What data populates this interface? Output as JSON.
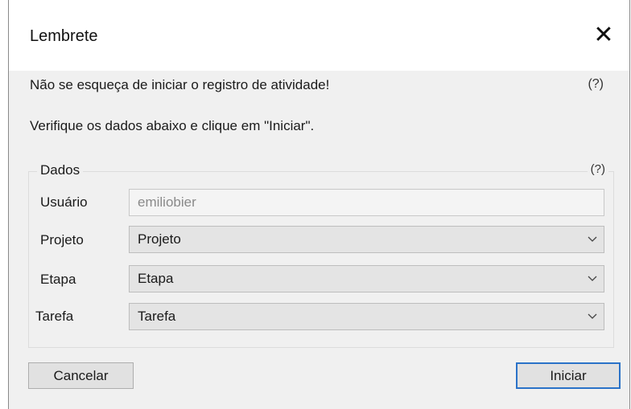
{
  "dialog": {
    "title": "Lembrete",
    "close_glyph": "✕",
    "message_1": "Não se esqueça de iniciar o registro de atividade!",
    "message_2": "Verifique os dados abaixo e clique em \"Iniciar\".",
    "help_top": "(?)"
  },
  "group": {
    "label": "Dados",
    "help": "(?)",
    "user_label": "Usuário",
    "user_value": "emiliobier",
    "project_label": "Projeto",
    "project_value": "Projeto",
    "stage_label": "Etapa",
    "stage_value": "Etapa",
    "task_label": "Tarefa",
    "task_value": "Tarefa"
  },
  "buttons": {
    "cancel": "Cancelar",
    "start": "Iniciar"
  },
  "colors": {
    "accent_border": "#2a72c8"
  },
  "icons": {
    "close": "close-icon",
    "dropdown": "chevron-down-icon"
  }
}
